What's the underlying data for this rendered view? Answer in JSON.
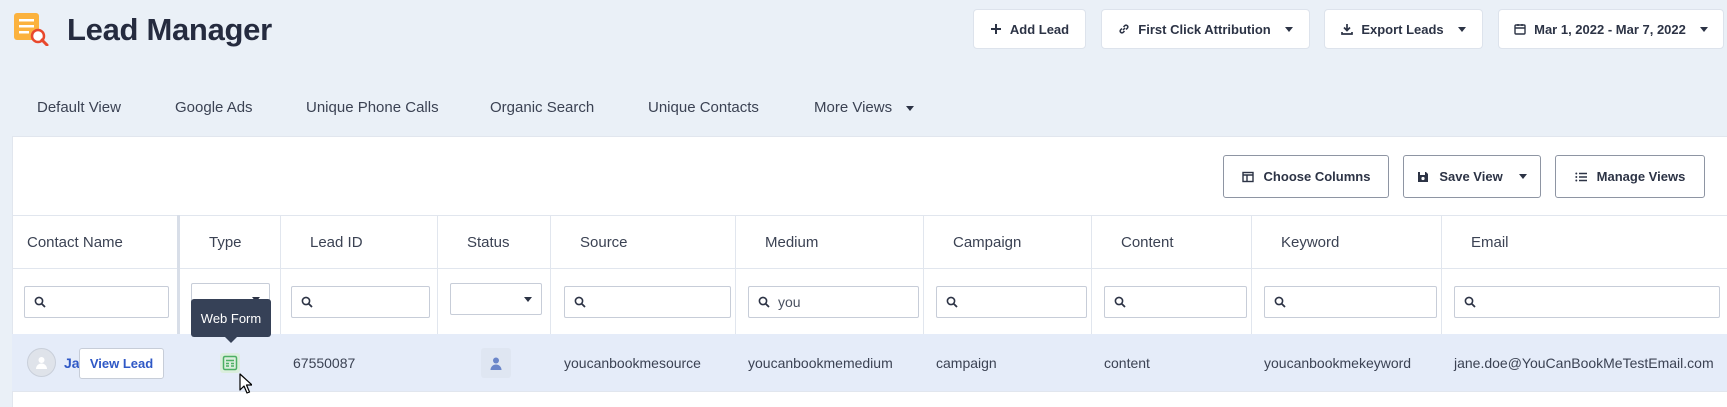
{
  "header": {
    "title": "Lead Manager",
    "buttons": {
      "add_lead": "Add Lead",
      "attribution": "First Click Attribution",
      "export": "Export Leads",
      "date_range": "Mar 1, 2022 - Mar 7, 2022"
    }
  },
  "tabs": [
    "Default View",
    "Google Ads",
    "Unique Phone Calls",
    "Organic Search",
    "Unique Contacts",
    "More Views"
  ],
  "toolbar": {
    "choose_columns": "Choose Columns",
    "save_view": "Save View",
    "manage_views": "Manage Views"
  },
  "columns": [
    "Contact Name",
    "Type",
    "Lead ID",
    "Status",
    "Source",
    "Medium",
    "Campaign",
    "Content",
    "Keyword",
    "Email"
  ],
  "filters": {
    "medium": "you"
  },
  "row": {
    "name_fragment": "Ja",
    "view_lead": "View Lead",
    "lead_id": "67550087",
    "source": "youcanbookmesource",
    "medium": "youcanbookmemedium",
    "campaign": "campaign",
    "content": "content",
    "keyword": "youcanbookmekeyword",
    "email": "jane.doe@YouCanBookMeTestEmail.com"
  },
  "tooltip": "Web Form",
  "colors": {
    "background": "#eaf0f7",
    "accent_orange": "#f58a3c",
    "link_blue": "#2f58c6",
    "row_highlight": "#e5ecf9",
    "tooltip_bg": "#364157"
  }
}
